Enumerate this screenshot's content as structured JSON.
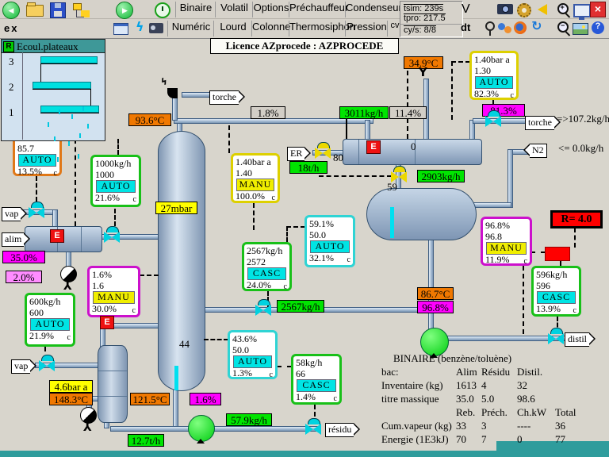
{
  "toolbar": {
    "ex": "ex",
    "v": "V",
    "dt": "dt",
    "row1": [
      "Binaire",
      "Volatil",
      "Options",
      "Préchauffeur",
      "Condenseur"
    ],
    "row2": [
      "Numéric",
      "Lourd",
      "Colonne",
      "Thermosiphon",
      "Pression",
      "cv"
    ],
    "tsim": "tsim: 239s",
    "tpro": "tpro: 217.5",
    "cys": "cy/s: 8/8"
  },
  "licence": "Licence AZprocede : AZPROCEDE",
  "tray_window": {
    "title": "Ecoul.plateaux",
    "r": "R",
    "trays": [
      "3",
      "2",
      "1"
    ]
  },
  "controllers": [
    {
      "id": "top-vap",
      "l1": "",
      "l2": "85.7",
      "mode": "AUTO",
      "op": "13.5%",
      "c": "c"
    },
    {
      "id": "alim-flow",
      "l1": "1000kg/h",
      "l2": "1000",
      "mode": "AUTO",
      "op": "21.6%",
      "c": "c"
    },
    {
      "id": "col-press-manu",
      "l1": "1.40bar a",
      "l2": "1.40",
      "mode": "MANU",
      "op": "100.0%",
      "c": "c"
    },
    {
      "id": "cond-press",
      "l1": "1.40bar a",
      "l2": "1.30",
      "mode": "AUTO",
      "op": "82.3%",
      "c": "c"
    },
    {
      "id": "drum-level",
      "l1": "59.1%",
      "l2": "50.0",
      "mode": "AUTO",
      "op": "32.1%",
      "c": "c"
    },
    {
      "id": "reflux-flow",
      "l1": "2567kg/h",
      "l2": "2572",
      "mode": "CASC",
      "op": "24.0%",
      "c": "c"
    },
    {
      "id": "feed-comp",
      "l1": "1.6%",
      "l2": "1.6",
      "mode": "MANU",
      "op": "30.0%",
      "c": "c"
    },
    {
      "id": "vap-flow",
      "l1": "600kg/h",
      "l2": "600",
      "mode": "AUTO",
      "op": "21.9%",
      "c": "c"
    },
    {
      "id": "col-level",
      "l1": "43.6%",
      "l2": "50.0",
      "mode": "AUTO",
      "op": "1.3%",
      "c": "c"
    },
    {
      "id": "residu-flow",
      "l1": "58kg/h",
      "l2": "66",
      "mode": "CASC",
      "op": "1.4%",
      "c": "c"
    },
    {
      "id": "distil-comp",
      "l1": "96.8%",
      "l2": "96.8",
      "mode": "MANU",
      "op": "11.9%",
      "c": "c"
    },
    {
      "id": "distil-flow",
      "l1": "596kg/h",
      "l2": "596",
      "mode": "CASC",
      "op": "13.9%",
      "c": "c"
    }
  ],
  "labels": {
    "t_93_6": "93.6°C",
    "pct_1_8": "1.8%",
    "f_3011": "3011kg/h",
    "pct_11_4": "11.4%",
    "t_34_9": "34.9°C",
    "pct_81_3": "81.3%",
    "p_27mbar": "27mbar",
    "f_18t": "18t/h",
    "f_2903": "2903kg/h",
    "f_2567": "2567kg/h",
    "pct_35": "35.0%",
    "pct_2": "2.0%",
    "p_4_6": "4.6bar a",
    "t_148_3": "148.3°C",
    "t_121_5": "121.5°C",
    "pct_1_6": "1.6%",
    "f_57_9": "57.9kg/h",
    "f_12_7": "12.7t/h",
    "t_86_7": "86.7°C",
    "pct_96_8": "96.8%",
    "r_display": "R= 4.0"
  },
  "texts": {
    "n80": "80",
    "n59": "59",
    "n44": "44",
    "n0": "0",
    "torch_flow": "=>107.2kg/h",
    "n2_flow": "<= 0.0kg/h",
    "e": "E"
  },
  "tags": {
    "torche_top": "torche",
    "torche_right": "torche",
    "n2": "N2",
    "vap_top": "vap",
    "alim": "alim",
    "vap_bottom": "vap",
    "residu": "résidu",
    "distil": "distil",
    "er": "ER"
  },
  "table": {
    "title": "BINAIRE (benzène/toluène)",
    "rows": [
      {
        "label": "bac:",
        "c1": "Alim",
        "c2": "Résidu",
        "c3": "Distil.",
        "c4": ""
      },
      {
        "label": "Inventaire (kg)",
        "c1": "1613",
        "c2": "4",
        "c3": "32",
        "c4": ""
      },
      {
        "label": "titre massique",
        "c1": "35.0",
        "c2": "5.0",
        "c3": "98.6",
        "c4": ""
      },
      {
        "label": "",
        "c1": "Reb.",
        "c2": "Préch.",
        "c3": "Ch.kW",
        "c4": "Total"
      },
      {
        "label": "Cum.vapeur (kg)",
        "c1": "33",
        "c2": "3",
        "c3": "----",
        "c4": "36"
      },
      {
        "label": "Energie (1E3kJ)",
        "c1": "70",
        "c2": "7",
        "c3": "0",
        "c4": "77"
      }
    ]
  },
  "colors": {
    "label_green": "#00e400",
    "label_orange": "#f07800",
    "label_magenta": "#ff00ff",
    "label_pink": "#ff8cff",
    "label_yellow": "#ffff00",
    "mode_auto": "#00e4e4",
    "mode_manu": "#f0ee00",
    "alarm_red": "#ff0000",
    "pipe_blue": "#9fb6cf",
    "pump_green": "#00cc10"
  }
}
